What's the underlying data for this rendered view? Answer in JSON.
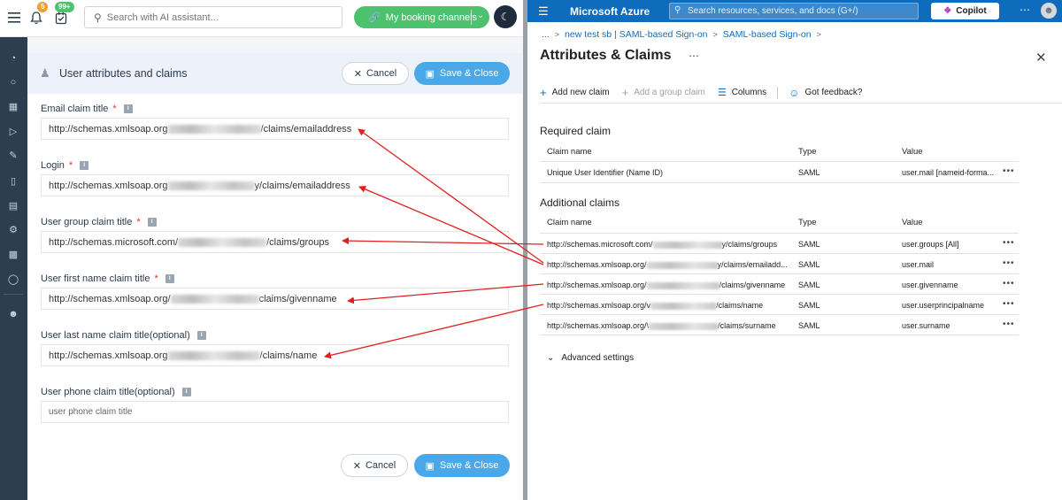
{
  "left_app": {
    "badges": {
      "notifications": "5",
      "tasks": "99+"
    },
    "search": {
      "placeholder": "Search with AI assistant..."
    },
    "booking_button": "My booking channels",
    "card_title": "User attributes and claims",
    "cancel_label": "Cancel",
    "save_label": "Save & Close",
    "fields": [
      {
        "label": "Email claim title",
        "required": true,
        "value_prefix": "http://schemas.xmlsoap.org",
        "value_suffix": "/claims/emailaddress"
      },
      {
        "label": "Login",
        "required": true,
        "value_prefix": "http://schemas.xmlsoap.org",
        "value_suffix": "y/claims/emailaddress"
      },
      {
        "label": "User group claim title",
        "required": true,
        "value_prefix": "http://schemas.microsoft.com/",
        "value_suffix": "/claims/groups"
      },
      {
        "label": "User first name claim title",
        "required": true,
        "value_prefix": "http://schemas.xmlsoap.org/",
        "value_suffix": "claims/givenname"
      },
      {
        "label": "User last name claim title(optional)",
        "required": false,
        "value_prefix": "http://schemas.xmlsoap.org",
        "value_suffix": "/claims/name"
      },
      {
        "label": "User phone claim title(optional)",
        "required": false,
        "placeholder": "user phone claim title"
      }
    ]
  },
  "azure": {
    "brand": "Microsoft Azure",
    "search_placeholder": "Search resources, services, and docs (G+/)",
    "copilot": "Copilot",
    "breadcrumbs": [
      "...",
      "new test sb | SAML-based Sign-on",
      "SAML-based Sign-on"
    ],
    "page_title": "Attributes & Claims",
    "commands": {
      "add_new_claim": "Add new claim",
      "add_group_claim": "Add a group claim",
      "columns": "Columns",
      "feedback": "Got feedback?"
    },
    "required_section": "Required claim",
    "additional_section": "Additional claims",
    "columns": [
      "Claim name",
      "Type",
      "Value"
    ],
    "required_rows": [
      {
        "name": "Unique User Identifier (Name ID)",
        "type": "SAML",
        "value": "user.mail [nameid-forma..."
      }
    ],
    "additional_rows": [
      {
        "name_prefix": "http://schemas.microsoft.com/",
        "name_suffix": "y/claims/groups",
        "type": "SAML",
        "value": "user.groups [All]"
      },
      {
        "name_prefix": "http://schemas.xmlsoap.org/",
        "name_suffix": "y/claims/emailadd...",
        "type": "SAML",
        "value": "user.mail"
      },
      {
        "name_prefix": "http://schemas.xmlsoap.org/",
        "name_suffix": "/claims/givenname",
        "type": "SAML",
        "value": "user.givenname"
      },
      {
        "name_prefix": "http://schemas.xmlsoap.org/v",
        "name_suffix": "/claims/name",
        "type": "SAML",
        "value": "user.userprincipalname"
      },
      {
        "name_prefix": "http://schemas.xmlsoap.org/\\",
        "name_suffix": "/claims/surname",
        "type": "SAML",
        "value": "user.surname"
      }
    ],
    "advanced_settings": "Advanced settings"
  },
  "colors": {
    "azure_blue": "#0f6cbd",
    "save_blue": "#4aa8e8",
    "booking_green": "#4cc26e",
    "arrow_red": "#e02020",
    "rail_dark": "#2c3e50"
  }
}
